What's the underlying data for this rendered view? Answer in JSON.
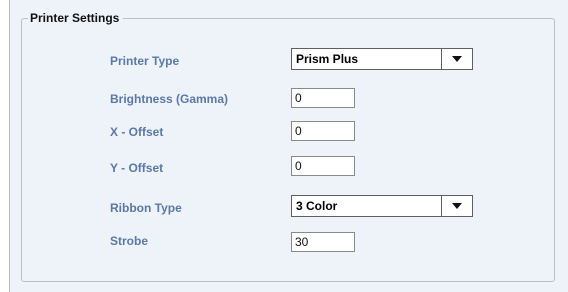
{
  "group_title": "Printer Settings",
  "fields": {
    "printer_type": {
      "label": "Printer Type",
      "value": "Prism Plus"
    },
    "brightness": {
      "label": "Brightness (Gamma)",
      "value": "0"
    },
    "x_offset": {
      "label": "X - Offset",
      "value": "0"
    },
    "y_offset": {
      "label": "Y - Offset",
      "value": "0"
    },
    "ribbon_type": {
      "label": "Ribbon Type",
      "value": "3 Color"
    },
    "strobe": {
      "label": "Strobe",
      "value": "30"
    }
  },
  "icons": {
    "dropdown_arrow": "chevron-down-icon"
  },
  "colors": {
    "panel_background": "#eef3fa",
    "label_text": "#5a78a8",
    "group_border": "#b4c0d0"
  }
}
